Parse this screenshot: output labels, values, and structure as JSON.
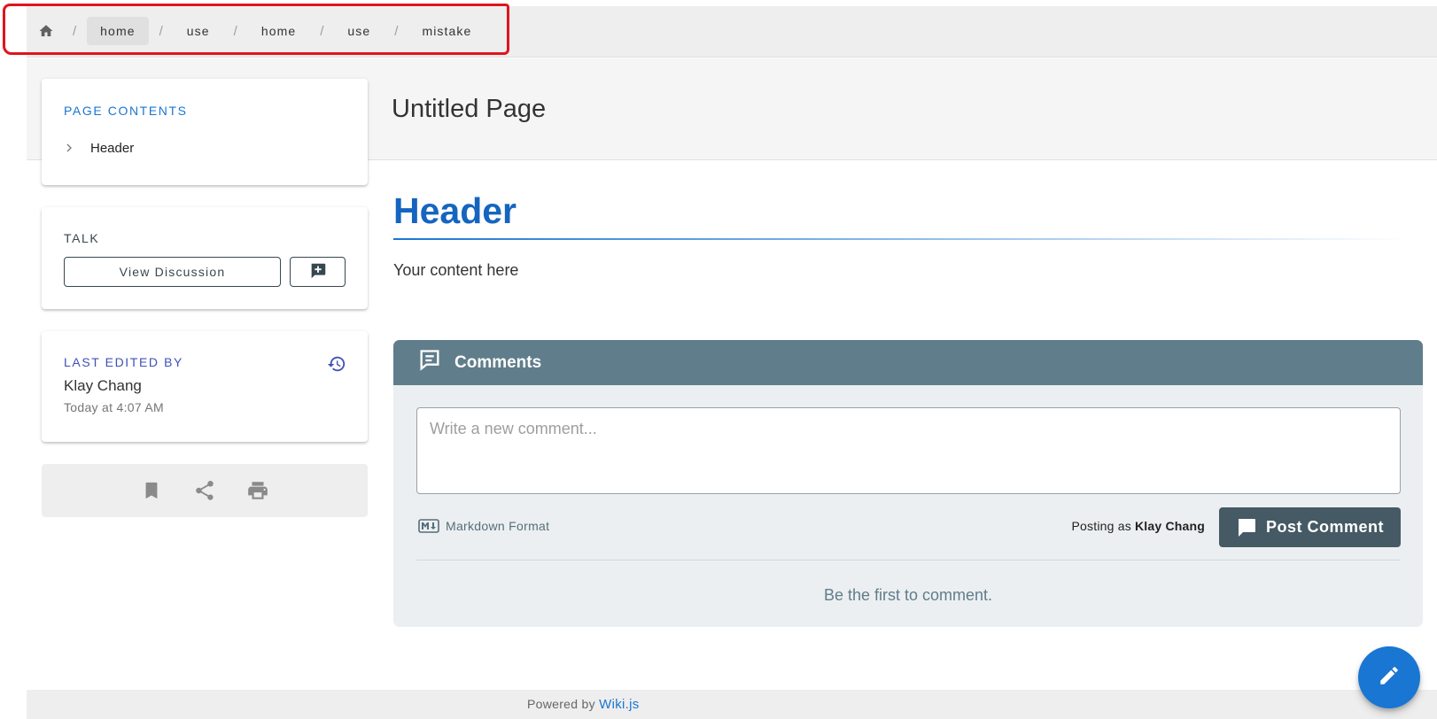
{
  "breadcrumb": {
    "home_icon": "home-icon",
    "separator": "/",
    "items": [
      "home",
      "use",
      "home",
      "use",
      "mistake"
    ]
  },
  "page": {
    "title": "Untitled Page"
  },
  "toc": {
    "label": "PAGE CONTENTS",
    "items": [
      "Header"
    ]
  },
  "talk": {
    "label": "TALK",
    "view_discussion": "View Discussion",
    "new_comment_icon": "comment-plus-icon"
  },
  "last_edited": {
    "label": "LAST EDITED BY",
    "author": "Klay Chang",
    "time": "Today at 4:07 AM",
    "history_icon": "history-icon"
  },
  "actions": [
    "bookmark-icon",
    "share-icon",
    "print-icon"
  ],
  "content": {
    "header": "Header",
    "body": "Your content here"
  },
  "comments": {
    "title": "Comments",
    "placeholder": "Write a new comment...",
    "markdown_label": "Markdown Format",
    "posting_as_prefix": "Posting as",
    "posting_as_user": "Klay Chang",
    "post_button": "Post Comment",
    "empty_message": "Be the first to comment."
  },
  "footer": {
    "powered_by": "Powered by",
    "link": "Wiki.js"
  },
  "colors": {
    "accent": "#1976d2",
    "comments_header": "#607d8b",
    "post_button": "#455a64",
    "annotation": "#e0141e"
  }
}
